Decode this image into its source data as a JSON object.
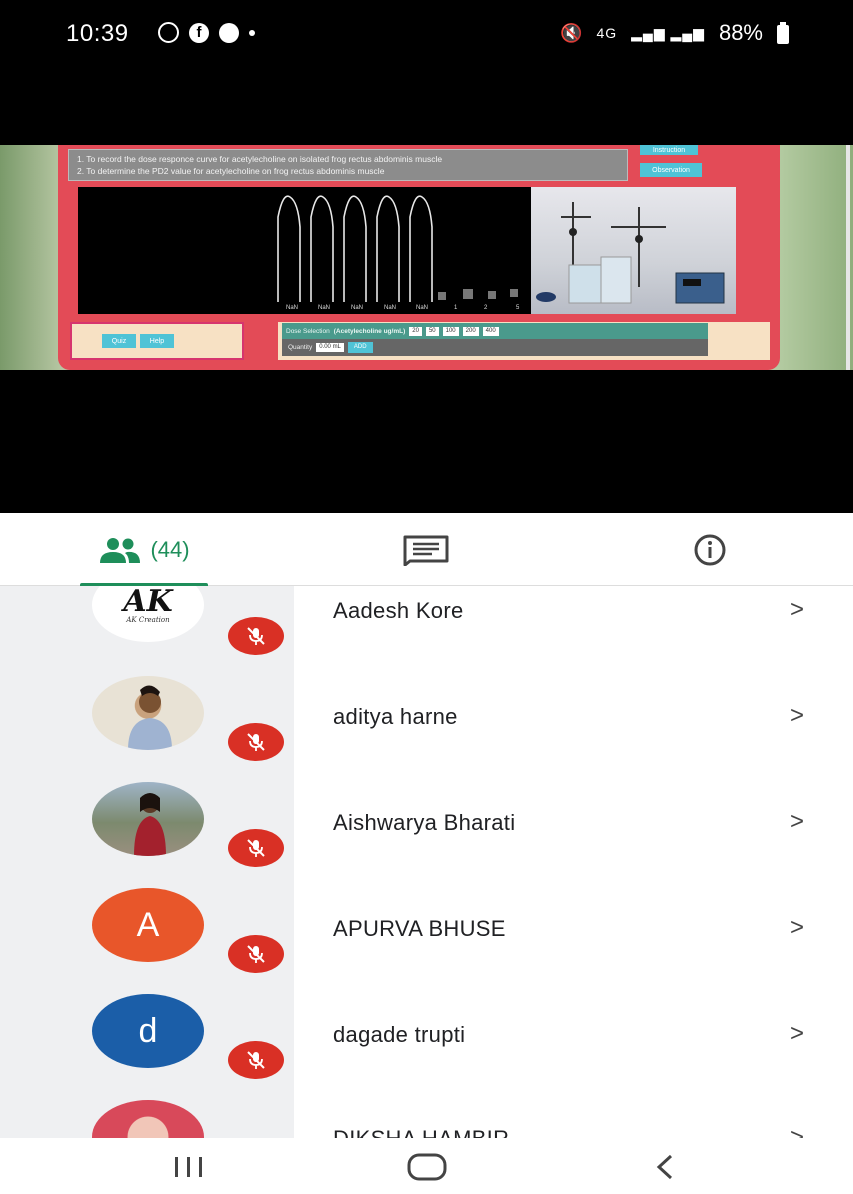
{
  "status_bar": {
    "time": "10:39",
    "notification_icons": [
      "whatsapp-icon",
      "facebook-icon",
      "phone-icon",
      "dot-icon"
    ],
    "network_label": "4G",
    "battery": "88%"
  },
  "video": {
    "aims": [
      "1. To record the dose responce curve for acetylecholine on isolated frog rectus abdominis muscle",
      "2. To determine the PD2 value for acetylecholine on frog rectus abdominis muscle"
    ],
    "corner_buttons": [
      "Instruction",
      "Observation"
    ],
    "graph_labels": [
      "NaN",
      "NaN",
      "NaN",
      "NaN",
      "NaN",
      "1",
      "2",
      "5"
    ],
    "quiz_label": "Quiz",
    "help_label": "Help",
    "dose_label": "Dose Selection",
    "dose_drug": "(Acetylecholine ug/mL)",
    "dose_options": [
      "20",
      "50",
      "100",
      "200",
      "400"
    ],
    "dose_selected": "100",
    "quantity_label": "Quantity",
    "quantity_value": "0.00 mL",
    "add_label": "ADD"
  },
  "tabs": {
    "people_count": "(44)",
    "active": "people"
  },
  "participants": [
    {
      "name": "Aadesh Kore",
      "avatar_type": "logo",
      "avatar_text": "AK",
      "avatar_subtext": "AK Creation",
      "muted": true
    },
    {
      "name": "aditya harne",
      "avatar_type": "photo",
      "muted": true
    },
    {
      "name": "Aishwarya Bharati",
      "avatar_type": "photo",
      "muted": true
    },
    {
      "name": "APURVA BHUSE",
      "avatar_type": "letter",
      "avatar_text": "A",
      "avatar_color": "#e8562a",
      "muted": true
    },
    {
      "name": "dagade trupti",
      "avatar_type": "letter",
      "avatar_text": "d",
      "avatar_color": "#1b5ea8",
      "muted": true
    },
    {
      "name": "DIKSHA HAMBIR",
      "avatar_type": "photo",
      "muted": false
    }
  ],
  "colors": {
    "accent_green": "#1e8e5a",
    "mute_red": "#d93025",
    "panel_red": "#e34b57"
  }
}
